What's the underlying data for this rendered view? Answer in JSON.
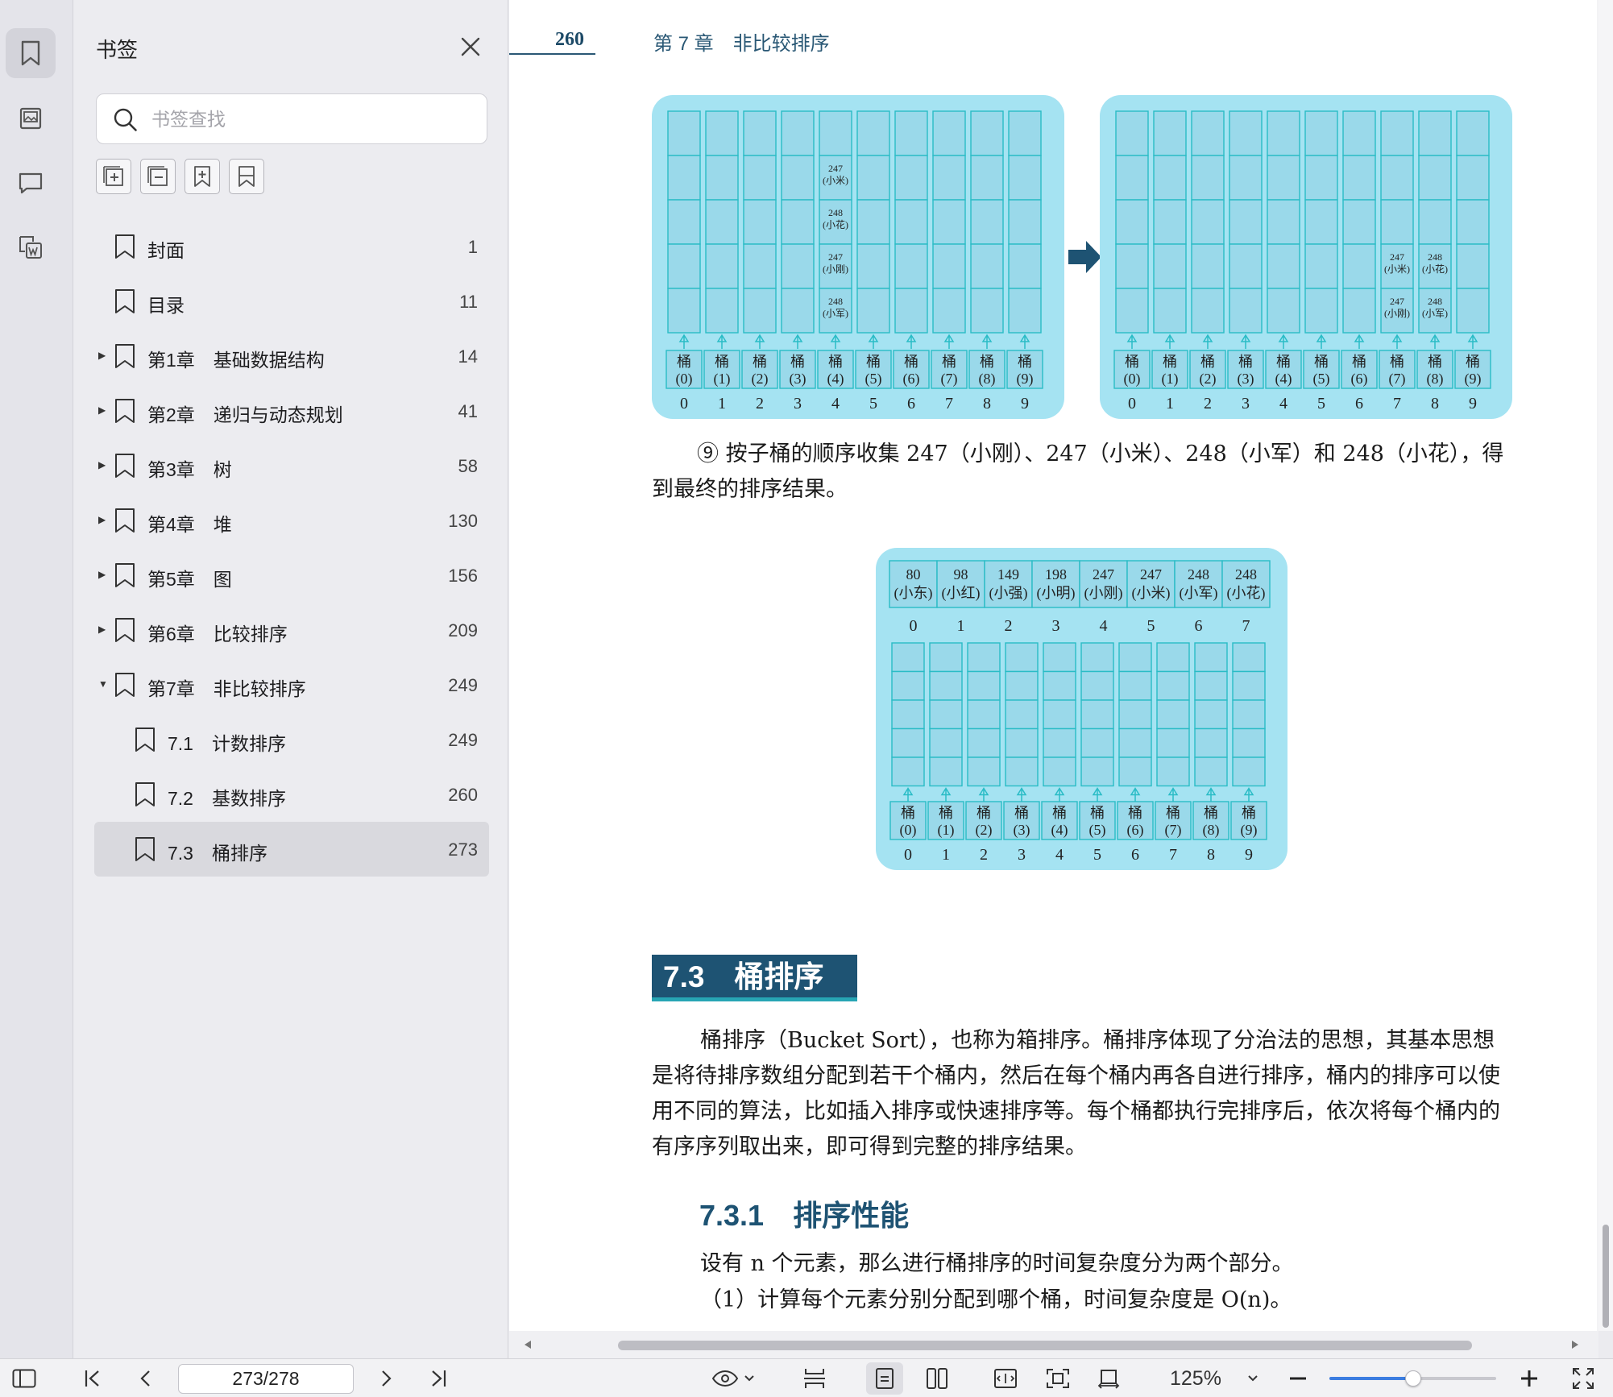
{
  "sidebar": {
    "title": "书签",
    "search_placeholder": "书签查找",
    "items": [
      {
        "label": "封面",
        "page": "1",
        "level": 0,
        "expandable": false,
        "expanded": false,
        "selected": false
      },
      {
        "label": "目录",
        "page": "11",
        "level": 0,
        "expandable": false,
        "expanded": false,
        "selected": false
      },
      {
        "label": "第1章　基础数据结构",
        "page": "14",
        "level": 0,
        "expandable": true,
        "expanded": false,
        "selected": false
      },
      {
        "label": "第2章　递归与动态规划",
        "page": "41",
        "level": 0,
        "expandable": true,
        "expanded": false,
        "selected": false
      },
      {
        "label": "第3章　树",
        "page": "58",
        "level": 0,
        "expandable": true,
        "expanded": false,
        "selected": false
      },
      {
        "label": "第4章　堆",
        "page": "130",
        "level": 0,
        "expandable": true,
        "expanded": false,
        "selected": false
      },
      {
        "label": "第5章　图",
        "page": "156",
        "level": 0,
        "expandable": true,
        "expanded": false,
        "selected": false
      },
      {
        "label": "第6章　比较排序",
        "page": "209",
        "level": 0,
        "expandable": true,
        "expanded": false,
        "selected": false
      },
      {
        "label": "第7章　非比较排序",
        "page": "249",
        "level": 0,
        "expandable": true,
        "expanded": true,
        "selected": false
      },
      {
        "label": "7.1　计数排序",
        "page": "249",
        "level": 1,
        "expandable": false,
        "expanded": false,
        "selected": false
      },
      {
        "label": "7.2　基数排序",
        "page": "260",
        "level": 1,
        "expandable": false,
        "expanded": false,
        "selected": false
      },
      {
        "label": "7.3　桶排序",
        "page": "273",
        "level": 1,
        "expandable": false,
        "expanded": false,
        "selected": true
      }
    ]
  },
  "page": {
    "number": "260",
    "chapter": "第 7 章　非比较排序",
    "fig_top": {
      "left": {
        "cells": [
          {
            "b": 4,
            "r": 1,
            "v": "247",
            "n": "(小米)"
          },
          {
            "b": 4,
            "r": 2,
            "v": "248",
            "n": "(小花)"
          },
          {
            "b": 4,
            "r": 3,
            "v": "247",
            "n": "(小刚)"
          },
          {
            "b": 4,
            "r": 4,
            "v": "248",
            "n": "(小军)"
          }
        ]
      },
      "right": {
        "cells": [
          {
            "b": 7,
            "r": 3,
            "v": "247",
            "n": "(小米)"
          },
          {
            "b": 8,
            "r": 3,
            "v": "248",
            "n": "(小花)"
          },
          {
            "b": 7,
            "r": 4,
            "v": "247",
            "n": "(小刚)"
          },
          {
            "b": 8,
            "r": 4,
            "v": "248",
            "n": "(小军)"
          }
        ]
      }
    },
    "bucket_char": "桶",
    "bucket_nums": [
      "(0)",
      "(1)",
      "(2)",
      "(3)",
      "(4)",
      "(5)",
      "(6)",
      "(7)",
      "(8)",
      "(9)"
    ],
    "indices": [
      "0",
      "1",
      "2",
      "3",
      "4",
      "5",
      "6",
      "7",
      "8",
      "9"
    ],
    "step9": "⑨ 按子桶的顺序收集 247（小刚）、247（小米）、248（小军）和 248（小花），得到最终的排序结果。",
    "result": {
      "values": [
        "80",
        "98",
        "149",
        "198",
        "247",
        "247",
        "248",
        "248"
      ],
      "names": [
        "(小东)",
        "(小红)",
        "(小强)",
        "(小明)",
        "(小刚)",
        "(小米)",
        "(小军)",
        "(小花)"
      ],
      "indices": [
        "0",
        "1",
        "2",
        "3",
        "4",
        "5",
        "6",
        "7"
      ]
    },
    "section": "7.3　桶排序",
    "para1": "桶排序（Bucket Sort），也称为箱排序。桶排序体现了分治法的思想，其基本思想是将待排序数组分配到若干个桶内，然后在每个桶内再各自进行排序，桶内的排序可以使用不同的算法，比如插入排序或快速排序等。每个桶都执行完排序后，依次将每个桶内的有序序列取出来，即可得到完整的排序结果。",
    "subsection": "7.3.1　排序性能",
    "para2": "设有 n 个元素，那么进行桶排序的时间复杂度分为两个部分。",
    "para3": "（1）计算每个元素分别分配到哪个桶，时间复杂度是 O(n)。"
  },
  "status": {
    "page_field": "273/278",
    "zoom": "125%",
    "zoom_fraction": 0.5
  },
  "colors": {
    "figure_bg": "#a5e3f2",
    "cell_stroke": "#2abcc6",
    "heading_bg": "#1e5373",
    "accent": "#3b7de0"
  }
}
